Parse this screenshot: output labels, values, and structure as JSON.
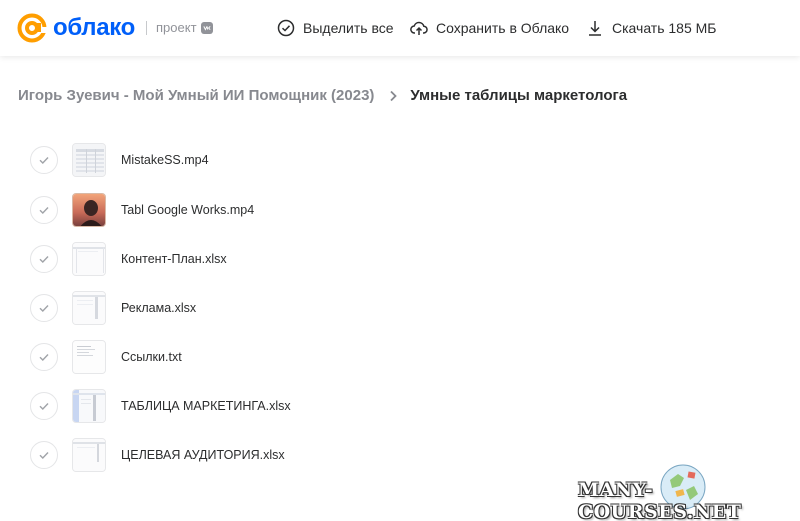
{
  "header": {
    "logo_text": "облако",
    "logo_sub": "проект",
    "actions": {
      "select_all": "Выделить все",
      "save_to_cloud": "Сохранить в Облако",
      "download": "Скачать 185 МБ"
    }
  },
  "breadcrumb": {
    "parent": "Игорь Зуевич - Мой Умный ИИ Помощник (2023)",
    "current": "Умные таблицы маркетолога"
  },
  "files": [
    {
      "name": "MistakeSS.mp4",
      "thumb": "sheet-video"
    },
    {
      "name": "Tabl Google Works.mp4",
      "thumb": "photo"
    },
    {
      "name": "Контент-План.xlsx",
      "thumb": "sheet"
    },
    {
      "name": "Реклама.xlsx",
      "thumb": "sheet"
    },
    {
      "name": "Ссылки.txt",
      "thumb": "text"
    },
    {
      "name": "ТАБЛИЦА МАРКЕТИНГА.xlsx",
      "thumb": "sheet-blue"
    },
    {
      "name": "ЦЕЛЕВАЯ АУДИТОРИЯ.xlsx",
      "thumb": "sheet"
    }
  ],
  "watermark": "MANY-COURSES.NET",
  "colors": {
    "brand": "#005ff9",
    "brand_accent": "#ff9e00",
    "text": "#2c2d2e",
    "muted": "#87898f"
  }
}
